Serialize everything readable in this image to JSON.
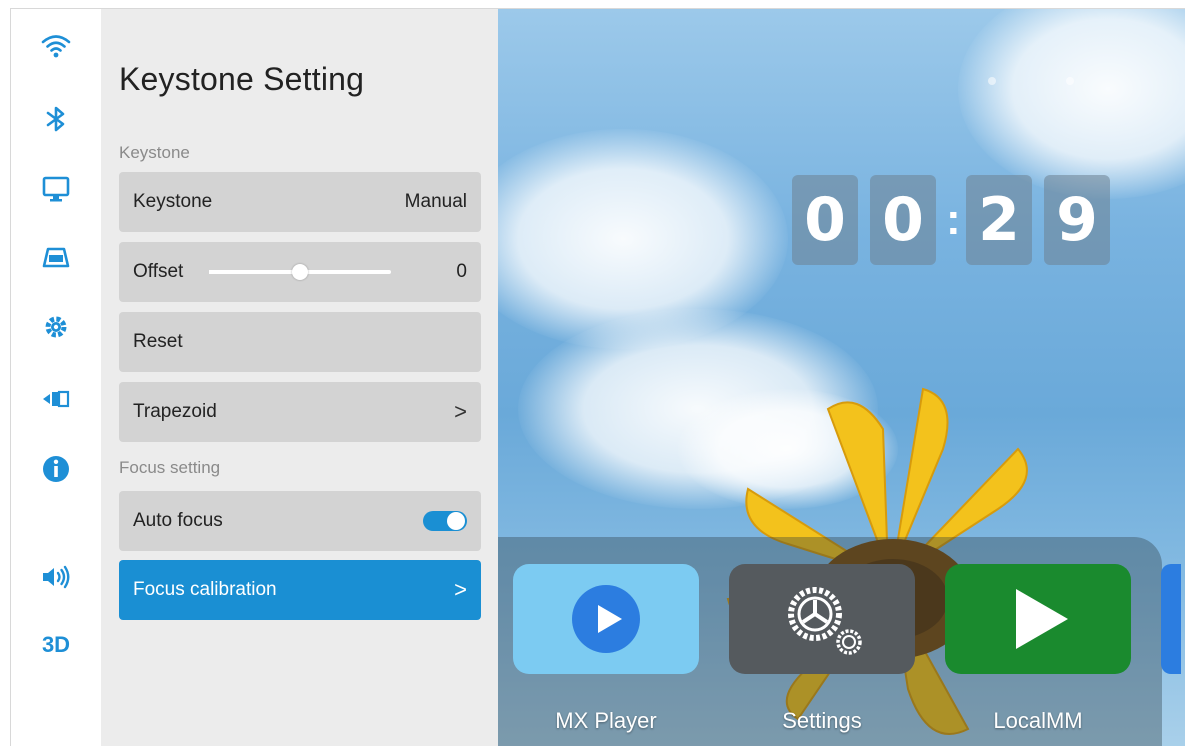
{
  "rail": {
    "items": [
      {
        "icon": "wifi-icon"
      },
      {
        "icon": "bluetooth-icon"
      },
      {
        "icon": "display-icon"
      },
      {
        "icon": "keystone-icon"
      },
      {
        "icon": "settings-gear-icon"
      },
      {
        "icon": "input-source-icon"
      },
      {
        "icon": "info-icon"
      },
      {
        "icon": "volume-icon"
      },
      {
        "icon": "3d-icon",
        "label": "3D"
      }
    ],
    "accent": "#1e8fd6"
  },
  "panel": {
    "title": "Keystone Setting",
    "keystone_section": "Keystone",
    "rows": {
      "keystone": {
        "label": "Keystone",
        "value": "Manual"
      },
      "offset": {
        "label": "Offset",
        "value": "0",
        "slider_fraction": 0.5
      },
      "reset": {
        "label": "Reset"
      },
      "trapezoid": {
        "label": "Trapezoid",
        "chevron": ">"
      }
    },
    "focus_section": "Focus setting",
    "focus_rows": {
      "auto_focus": {
        "label": "Auto focus",
        "enabled": true
      },
      "focus_calibration": {
        "label": "Focus calibration",
        "chevron": ">",
        "selected": true
      }
    },
    "selected_color": "#1a8fd3"
  },
  "clock": {
    "digits": [
      "0",
      "0",
      "2",
      "9"
    ],
    "separator": ":"
  },
  "apps": [
    {
      "label": "MX Player",
      "icon": "mx-player-icon",
      "color": "#7ccbf2"
    },
    {
      "label": "Settings",
      "icon": "settings-app-icon",
      "color": "#555a5e"
    },
    {
      "label": "LocalMM",
      "icon": "localmm-play-icon",
      "color": "#1a8a2e"
    }
  ]
}
